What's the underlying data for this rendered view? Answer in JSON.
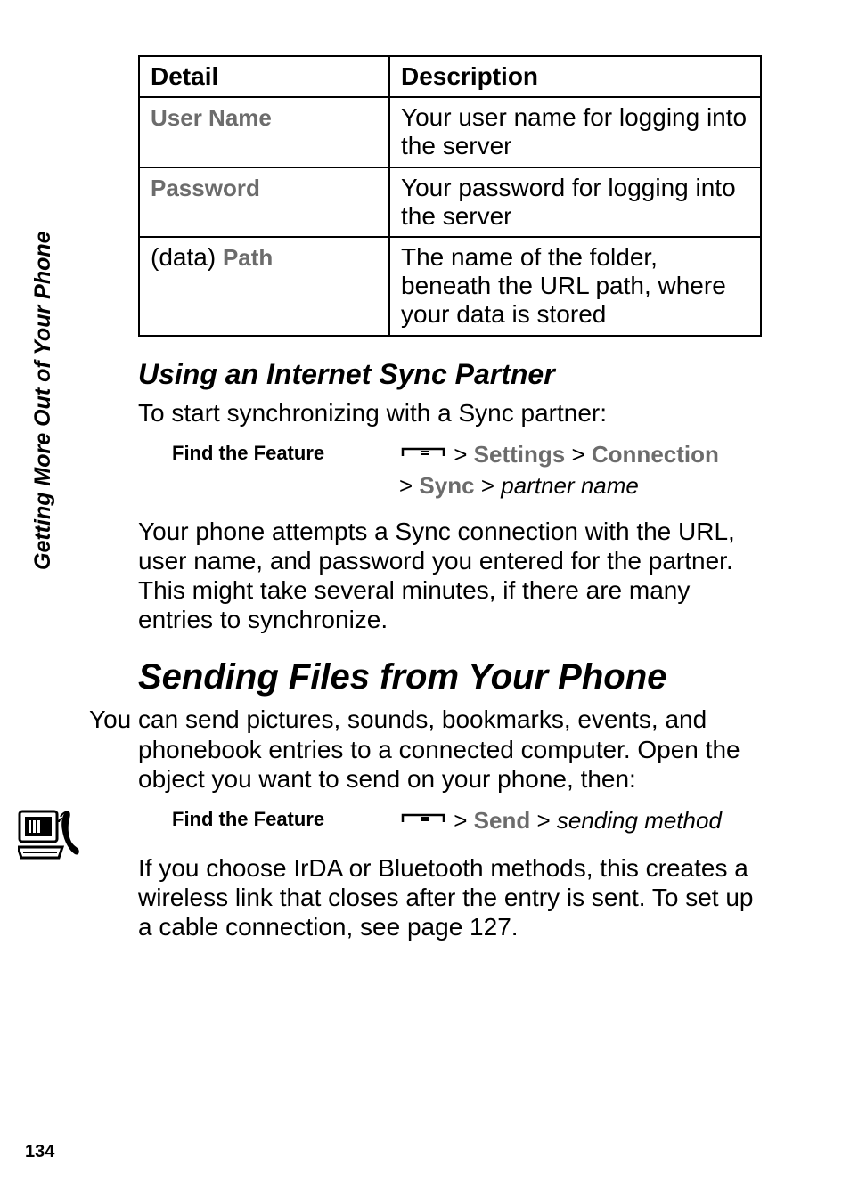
{
  "side_label": "Getting More Out of Your Phone",
  "page_number": "134",
  "table": {
    "headers": {
      "c1": "Detail",
      "c2": "Description"
    },
    "rows": [
      {
        "label": "User Name",
        "desc": "Your user name for logging into the server"
      },
      {
        "label": "Password",
        "desc": "Your password for logging into the server"
      },
      {
        "prefix": "(data) ",
        "label": "Path",
        "desc": "The name of the folder, beneath the URL path, where your data is stored"
      }
    ]
  },
  "section1": {
    "heading": "Using an Internet Sync Partner",
    "intro": "To start synchronizing with a Sync partner:",
    "feature_label": "Find the Feature",
    "path": {
      "s1": "Settings",
      "s2": "Connection",
      "s3": "Sync",
      "s4": "partner name"
    },
    "body": "Your phone attempts a Sync connection with the URL, user name, and password you entered for the partner. This might take several minutes, if there are many entries to synchronize."
  },
  "section2": {
    "heading": "Sending Files from Your Phone",
    "intro": "You can send pictures, sounds, bookmarks, events, and phonebook entries to a connected computer. Open the object you want to send on your phone, then:",
    "feature_label": "Find the Feature",
    "path": {
      "s1": "Send",
      "s2": "sending method"
    },
    "body": "If you choose IrDA or Bluetooth methods, this creates a wireless link that closes after the entry is sent. To set up a cable connection, see page 127."
  }
}
